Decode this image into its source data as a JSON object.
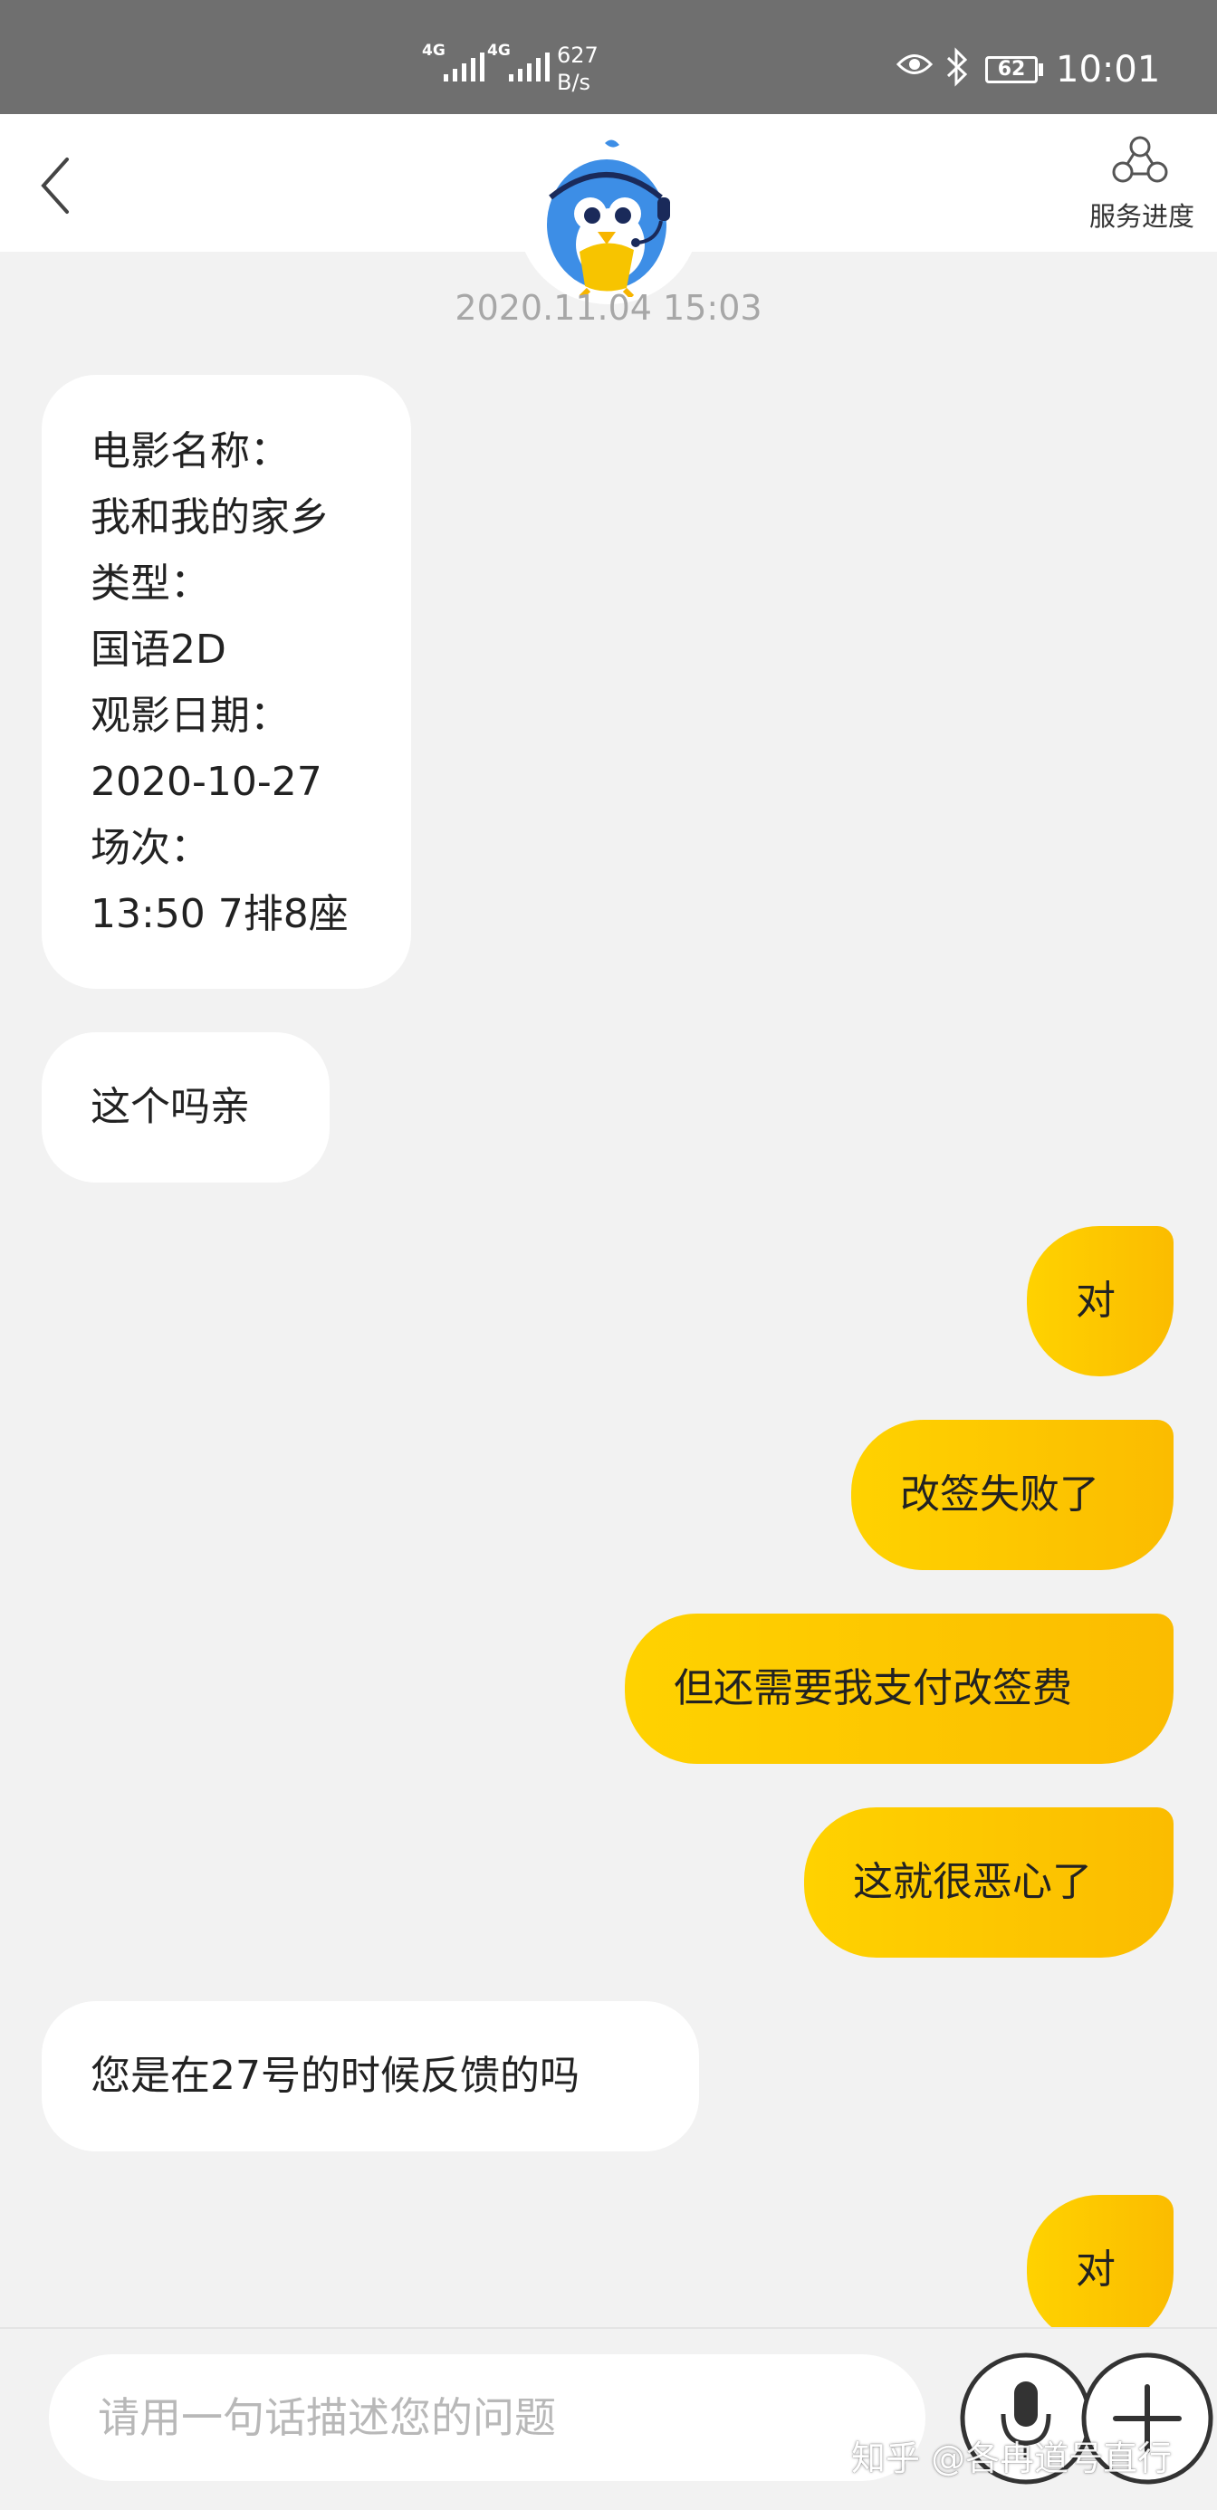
{
  "status_bar": {
    "network_1": "4G",
    "network_2": "4G",
    "speed_value": "627",
    "speed_unit": "B/s",
    "battery": "62",
    "time": "10:01"
  },
  "header": {
    "service_progress_label": "服务进度"
  },
  "chat": {
    "timestamp": "2020.11.04 15:03",
    "messages": [
      {
        "side": "left",
        "lines": [
          "电影名称：",
          "我和我的家乡",
          "类型：",
          "国语2D",
          "观影日期：",
          "2020-10-27",
          "场次：",
          "13:50 7排8座"
        ]
      },
      {
        "side": "left",
        "lines": [
          "这个吗亲"
        ]
      },
      {
        "side": "right",
        "lines": [
          "对"
        ]
      },
      {
        "side": "right",
        "lines": [
          "改签失败了"
        ]
      },
      {
        "side": "right",
        "lines": [
          "但还需要我支付改签费"
        ]
      },
      {
        "side": "right",
        "lines": [
          "这就很恶心了"
        ]
      },
      {
        "side": "left",
        "lines": [
          "您是在27号的时候反馈的吗"
        ]
      },
      {
        "side": "right",
        "lines": [
          "对"
        ]
      }
    ]
  },
  "input_bar": {
    "placeholder": "请用一句话描述您的问题"
  },
  "watermark": "知乎 @各冉道号直行",
  "colors": {
    "status_bar_bg": "#6f6f6f",
    "user_bubble": "#ffc800",
    "agent_bubble": "#ffffff",
    "chat_bg": "#f2f2f2"
  }
}
